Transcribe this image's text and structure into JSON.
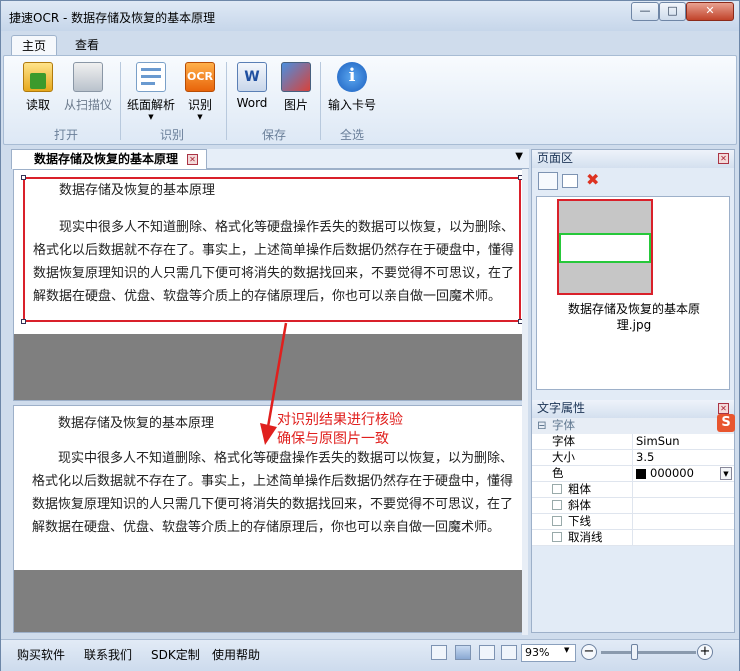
{
  "window": {
    "title": "捷速OCR - 数据存储及恢复的基本原理",
    "min_label": "—",
    "max_label": "□",
    "close_label": "✕"
  },
  "ribbon": {
    "tabs": [
      {
        "label": "主页"
      },
      {
        "label": "查看"
      }
    ],
    "buttons": [
      {
        "label": "读取",
        "icon": "folder-open-icon"
      },
      {
        "label": "从扫描仪",
        "icon": "scanner-icon"
      },
      {
        "label": "纸面解析",
        "icon": "page-analyze-icon"
      },
      {
        "label": "识别",
        "icon": "ocr-icon"
      },
      {
        "label": "Word",
        "icon": "word-icon"
      },
      {
        "label": "图片",
        "icon": "picture-icon"
      },
      {
        "label": "输入卡号",
        "icon": "info-icon"
      }
    ],
    "groups": [
      {
        "label": "打开"
      },
      {
        "label": "识别"
      },
      {
        "label": "保存"
      },
      {
        "label": "全选"
      }
    ],
    "ocr_glyph": "OCR",
    "info_glyph": "i"
  },
  "document": {
    "tab_label": "数据存储及恢复的基本原理",
    "menu_arrow": "▼",
    "close_glyph": "✕",
    "image": {
      "title": "数据存储及恢复的基本原理",
      "line1": "现实中很多人不知道删除、格式化等硬盘操作丢失的数据可以恢复，以为删除、",
      "line2": "格式化以后数据就不存在了。事实上，上述简单操作后数据仍然存在于硬盘中，懂得",
      "line3": "数据恢复原理知识的人只需几下便可将消失的数据找回来，不要觉得不可思议，在了",
      "line4": "解数据在硬盘、优盘、软盘等介质上的存储原理后，你也可以亲自做一回魔术师。"
    },
    "result": {
      "title": "数据存储及恢复的基本原理",
      "line1": "现实中很多人不知道删除、格式化等硬盘操作丢失的数据可以恢复，以为删除、",
      "line2": "格式化以后数据就不存在了。事实上，上述简单操作后数据仍然存在于硬盘中，懂得",
      "line3": "数据恢复原理知识的人只需几下便可将消失的数据找回来，不要觉得不可思议，在了",
      "line4": "解数据在硬盘、优盘、软盘等介质上的存储原理后，你也可以亲自做一回魔术师。"
    }
  },
  "annotation": {
    "line1": "对识别结果进行核验",
    "line2": "确保与原图片一致",
    "color": "#e0201e"
  },
  "page_panel": {
    "header": "页面区",
    "thumb_caption_line1": "数据存储及恢复的基本原",
    "thumb_caption_line2": "理.jpg"
  },
  "text_props": {
    "header": "文字属性",
    "group": "字体",
    "group_toggle": "⊟",
    "rows": [
      {
        "name": "字体",
        "value": "SimSun"
      },
      {
        "name": "大小",
        "value": "3.5"
      },
      {
        "name": "色",
        "value": "000000"
      }
    ],
    "checks": [
      {
        "name": "粗体"
      },
      {
        "name": "斜体"
      },
      {
        "name": "下线"
      },
      {
        "name": "取消线"
      }
    ]
  },
  "status": {
    "links": [
      {
        "label": "购买软件"
      },
      {
        "label": "联系我们"
      },
      {
        "label": "SDK定制"
      },
      {
        "label": "使用帮助"
      }
    ],
    "zoom": "93%",
    "zoom_minus": "−",
    "zoom_plus": "+"
  },
  "colors": {
    "accent_red": "#d9202a",
    "green": "#26c83a",
    "link_blue": "#1a5fd0"
  }
}
